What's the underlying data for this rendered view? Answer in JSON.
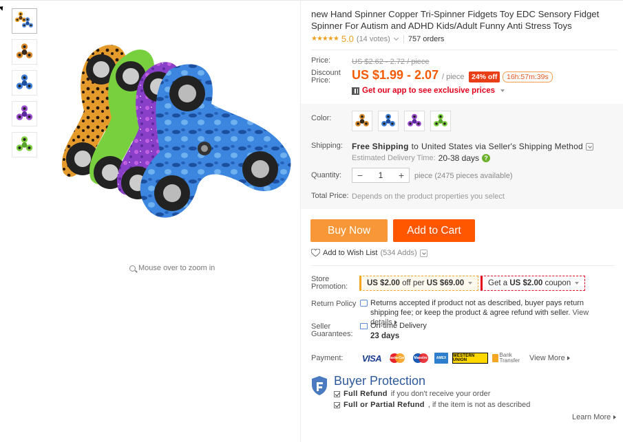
{
  "gallery": {
    "thumbnails": [
      {
        "name": "thumb-multi-spinners",
        "colors": [
          "#f0a020",
          "#5a8fe0",
          "#9b4fd0"
        ]
      },
      {
        "name": "thumb-leopard-spinner",
        "colors": [
          "#d9882a",
          "#3a2a1a",
          "#d9882a"
        ]
      },
      {
        "name": "thumb-blue-camo-spinner",
        "colors": [
          "#3d7fd9",
          "#1e4f9c",
          "#3d7fd9"
        ]
      },
      {
        "name": "thumb-purple-galaxy-spinner",
        "colors": [
          "#9b4fd0",
          "#5a2a9c",
          "#9b4fd0"
        ]
      },
      {
        "name": "thumb-green-spinner",
        "colors": [
          "#7fd040",
          "#5aa030",
          "#7fd040"
        ]
      }
    ],
    "zoom_hint": "Mouse over to zoom in"
  },
  "product": {
    "title": "new Hand Spinner Copper Tri-Spinner Fidgets Toy EDC Sensory Fidget Spinner For Autism and ADHD Kids/Adult Funny Anti Stress Toys",
    "stars": "★★★★★",
    "rating": "5.0",
    "votes": "(14 votes)",
    "orders": "757 orders"
  },
  "pricing": {
    "price_label": "Price:",
    "original_price": "US $2.62 - 2.72 / piece",
    "discount_label": "Discount Price:",
    "discount_price": "US $1.99 - 2.07",
    "per_piece": "/ piece",
    "off_badge": "24% off",
    "timer": "16h:57m:39s",
    "app_promo": "Get our app to see exclusive prices"
  },
  "options": {
    "color_label": "Color:",
    "swatches": [
      {
        "name": "swatch-leopard",
        "colors": [
          "#d9882a",
          "#3a2a1a"
        ]
      },
      {
        "name": "swatch-blue-camo",
        "colors": [
          "#3d7fd9",
          "#1e4f9c"
        ]
      },
      {
        "name": "swatch-purple",
        "colors": [
          "#9b4fd0",
          "#5a2a9c"
        ]
      },
      {
        "name": "swatch-green",
        "colors": [
          "#7fd040",
          "#5aa030"
        ]
      }
    ],
    "shipping_label": "Shipping:",
    "shipping_free": "Free Shipping",
    "shipping_to": "to",
    "shipping_dest": "United States via Seller's Shipping Method",
    "delivery_label": "Estimated Delivery Time:",
    "delivery_days": "20-38 days",
    "quantity_label": "Quantity:",
    "qty_minus": "−",
    "qty_plus": "+",
    "quantity": "1",
    "quantity_note": "piece (2475 pieces available)",
    "total_label": "Total Price:",
    "total_note": "Depends on the product properties you select"
  },
  "actions": {
    "buy_now": "Buy Now",
    "add_to_cart": "Add to Cart",
    "wishlist": "Add to Wish List",
    "wishlist_adds": "(534 Adds)"
  },
  "store": {
    "promotion_label": "Store Promotion:",
    "coupon1_amount": "US $2.00",
    "coupon1_mid": "off per",
    "coupon1_threshold": "US $69.00",
    "coupon2_pre": "Get a",
    "coupon2_amount": "US $2.00",
    "coupon2_post": "coupon",
    "return_label": "Return Policy",
    "return_text": "Returns accepted if product not as described, buyer pays return shipping fee; or keep the product & agree refund with seller.",
    "view_details": "View details",
    "guarantee_label": "Seller Guarantees:",
    "ontime": "On-time Delivery",
    "ontime_days": "23 days",
    "payment_label": "Payment:",
    "pay_visa": "VISA",
    "pay_mastercard": "MasterCard",
    "pay_maestro": "Maestro",
    "pay_amex": "AMEX",
    "pay_wu": "WESTERN UNION",
    "pay_bank": "Bank Transfer",
    "view_more": "View More"
  },
  "protection": {
    "title": "Buyer Protection",
    "line1_bold": "Full Refund",
    "line1_rest": "if you don't receive your order",
    "line2_bold": "Full or Partial Refund",
    "line2_rest": ", if the item is not as described",
    "learn_more": "Learn More"
  },
  "colors": {
    "accent_orange": "#f55a00",
    "buy_now": "#f89737",
    "add_to_cart": "#fe5700",
    "protection_blue": "#2e5a9c"
  }
}
